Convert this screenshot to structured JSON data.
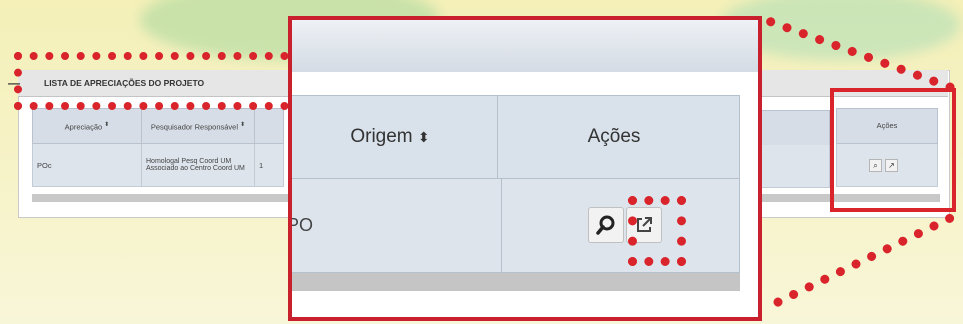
{
  "panel": {
    "title": "LISTA DE APRECIAÇÕES DO PROJETO",
    "collapse_symbol": "—"
  },
  "table": {
    "columns": [
      "Apreciação",
      "Pesquisador Responsável",
      "Origem",
      "Ações"
    ],
    "row": {
      "apreciacao": "POc",
      "pesquisador": "Homologal Pesq Coord UM Associado ao Centro Coord UM",
      "col3": "1",
      "origem_partial": "PO"
    }
  },
  "zoom": {
    "col_origem": "Origem",
    "col_acoes": "Ações",
    "origem_value": "PO"
  },
  "actions": {
    "view_icon": "magnifier-icon",
    "open_icon": "external-link-icon"
  },
  "colors": {
    "highlight": "#d8242a",
    "zoom_border": "#c8202c",
    "header_bg": "#d9e1ea",
    "row_bg": "#dde4ec"
  }
}
